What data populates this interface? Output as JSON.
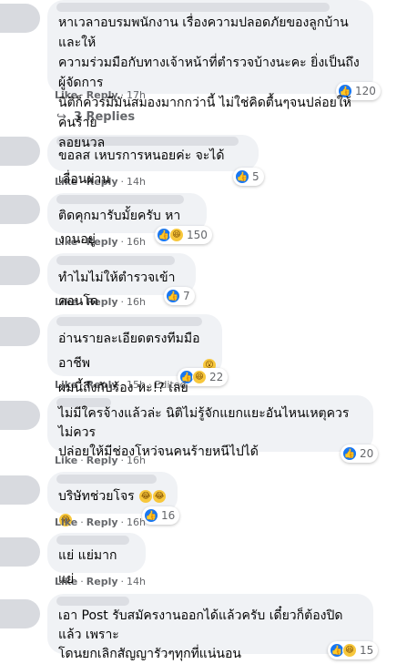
{
  "comments": [
    {
      "text": "หาเวลาอบรมพนักงาน เรื่องความปลอดภัยของลูกบ้านและให้\nความร่วมมือกับทางเจ้าหน้าที่ตำรวจบ้างนะคะ ยิ่งเป็นถึงผู้จัดการ\nนิติก็ควรมีมันสมองมากกว่านี้ ไม่ใช่คิดตื้นๆจนปล่อยให้คนร้าย\nลอยนวล",
      "like": "Like",
      "reply": "Reply",
      "time": "17h",
      "reaction_count": "120",
      "reactions": [
        "like-icon"
      ]
    },
    {
      "text": "ขอลส เหบรการหนอยค่ะ จะได้เลื่อนผ่าน",
      "like": "Like",
      "reply": "Reply",
      "time": "14h",
      "reaction_count": "5",
      "reactions": [
        "like-icon"
      ]
    },
    {
      "text": "ติดคุกมารับมั้ยครับ หางานอยู่",
      "like": "Like",
      "reply": "Reply",
      "time": "16h",
      "reaction_count": "150",
      "reactions": [
        "like-icon",
        "haha-icon"
      ]
    },
    {
      "text": "ทำไมไม่ให้ตำรวจเข้าคอนโด",
      "like": "Like",
      "reply": "Reply",
      "time": "16h",
      "reaction_count": "7",
      "reactions": [
        "like-icon"
      ]
    },
    {
      "text": "อ่านรายละเอียดตรงทีมมืออาชีพ\nผมนี้ถึงกับร้อง หะ!? เลย",
      "like": "Like",
      "reply": "Reply",
      "time": "15h",
      "edited": "Edited",
      "reaction_count": "22",
      "reactions": [
        "like-icon",
        "haha-icon"
      ]
    },
    {
      "text": "ไม่มีใครจ้างแล้วล่ะ นิติไม่รู้จักแยกแยะอันไหนเหตุควรไม่ควร\nปล่อยให้มีช่องโหว่จนคนร้ายหนีไปได้",
      "like": "Like",
      "reply": "Reply",
      "time": "16h",
      "reaction_count": "20",
      "reactions": [
        "like-icon"
      ]
    },
    {
      "text": "บริษัทช่วยโจร",
      "like": "Like",
      "reply": "Reply",
      "time": "16h",
      "reaction_count": "16",
      "reactions": [
        "like-icon"
      ]
    },
    {
      "text": "แย่ แย่มาก แย่",
      "like": "Like",
      "reply": "Reply",
      "time": "14h"
    },
    {
      "text": "เอา Post รับสมัครงานออกได้แล้วครับ เดี๋ยวก็ต้องปิดแล้ว เพราะ\nโดนยกเลิกสัญญารัวๆทุกที่แน่นอน",
      "reaction_count": "15",
      "reactions": [
        "like-icon",
        "haha-icon"
      ]
    }
  ],
  "replies_label": "3 Replies",
  "colors": {
    "like_blue": "#1877f2",
    "bubble_bg": "#f0f2f5",
    "meta_gray": "#65676b"
  }
}
